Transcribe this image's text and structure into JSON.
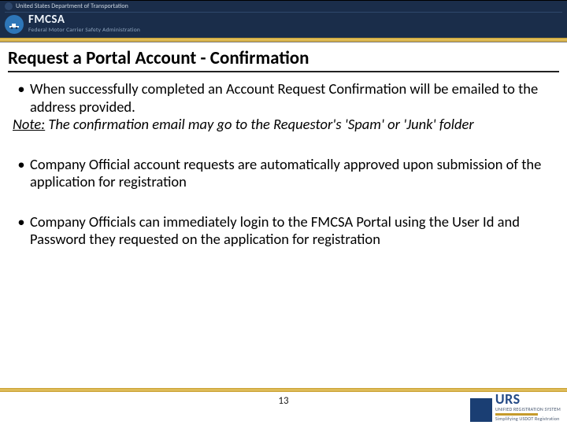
{
  "header": {
    "department": "United States Department of Transportation",
    "agency": "FMCSA",
    "agency_subtitle": "Federal Motor Carrier Safety Administration"
  },
  "title": "Request a Portal Account - Confirmation",
  "body": {
    "bullet1": "When successfully completed an Account Request Confirmation will be emailed to the address provided.",
    "note_label": "Note:",
    "note_text": " The confirmation email may go to the Requestor's 'Spam' or 'Junk' folder",
    "bullet2": "Company Official account requests are automatically approved upon submission of the application for registration",
    "bullet3": "Company Officials can immediately login to the FMCSA Portal using the User Id and Password they requested on the application for registration"
  },
  "footer": {
    "page": "13",
    "logo_main": "URS",
    "logo_sub1": "UNIFIED REGISTRATION SYSTEM",
    "logo_sub2": "Simplifying USDOT Registration"
  }
}
